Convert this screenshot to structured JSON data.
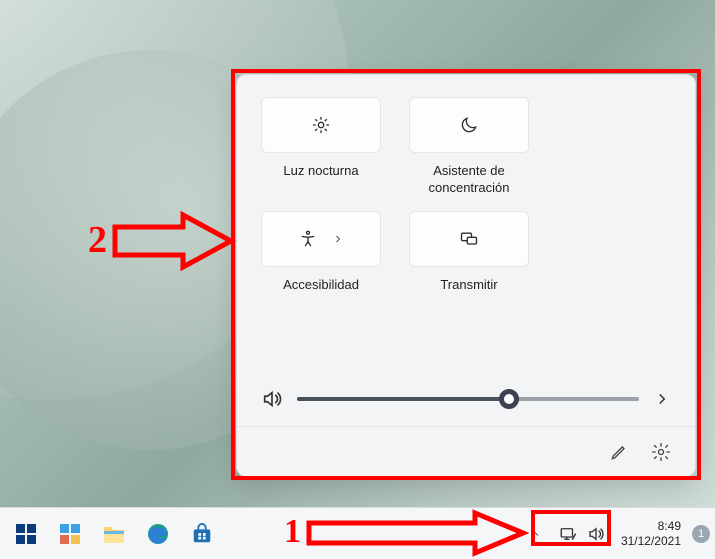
{
  "panel": {
    "tiles": [
      {
        "label": "Luz nocturna",
        "icon": "brightness"
      },
      {
        "label": "Asistente de concentración",
        "icon": "moon"
      },
      {
        "label": "Accesibilidad",
        "icon": "accessibility",
        "expand": true
      },
      {
        "label": "Transmitir",
        "icon": "cast"
      }
    ],
    "volume": {
      "level": 62
    },
    "footer": {
      "edit": "Editar",
      "settings": "Configuración"
    }
  },
  "taskbar": {
    "apps": [
      "start",
      "widgets",
      "explorer",
      "edge",
      "store"
    ],
    "clock": {
      "time": "8:49",
      "date": "31/12/2021"
    },
    "notifications": "1"
  },
  "annotations": {
    "label1": "1",
    "label2": "2"
  }
}
